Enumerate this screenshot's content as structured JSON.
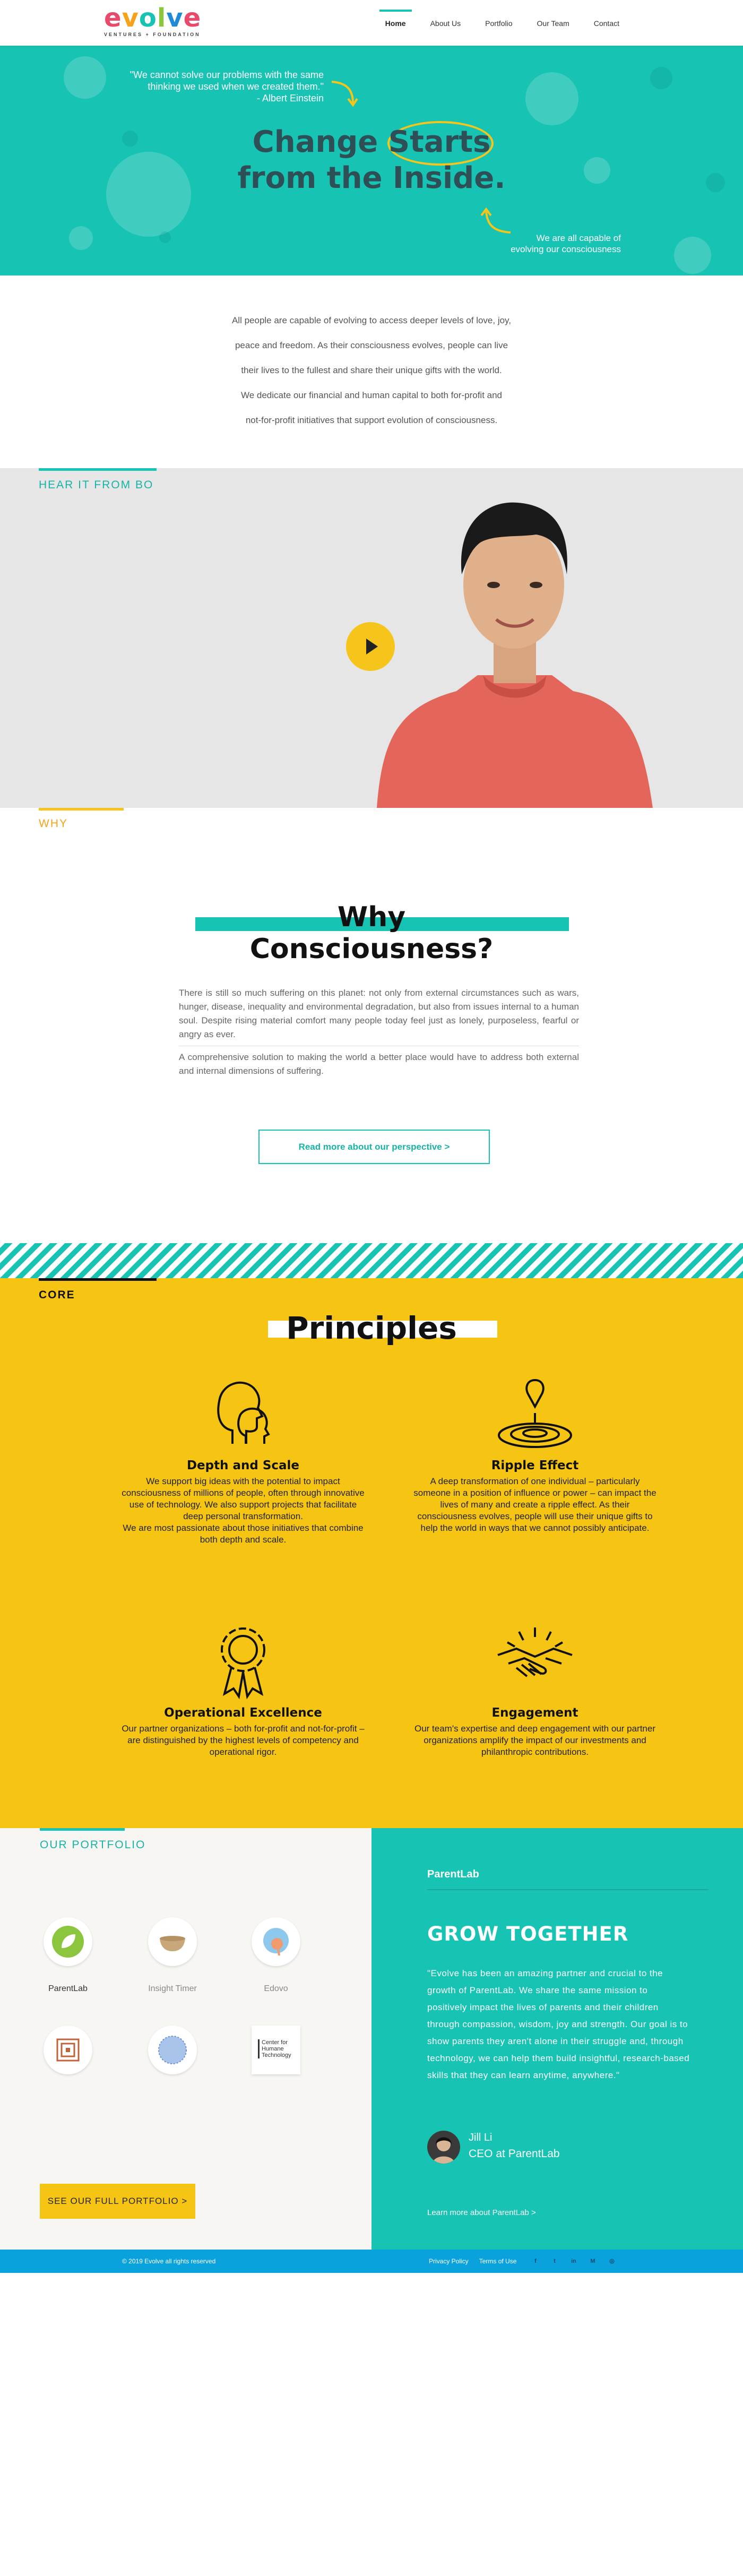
{
  "brand": {
    "logo_text": "evolve",
    "logo_sub": "VENTURES + FOUNDATION",
    "colors": {
      "teal": "#17c3b2",
      "yellow": "#f6c51b",
      "blue": "#0aa2dd"
    }
  },
  "nav": {
    "items": [
      {
        "label": "Home",
        "active": true
      },
      {
        "label": "About Us",
        "active": false
      },
      {
        "label": "Portfolio",
        "active": false
      },
      {
        "label": "Our Team",
        "active": false
      },
      {
        "label": "Contact",
        "active": false
      }
    ]
  },
  "hero": {
    "quote_line1": "\"We cannot solve our problems with the same",
    "quote_line2": "thinking we used when we created them.\"",
    "quote_author": "- Albert Einstein",
    "title_word1": "Change",
    "title_word2": "Starts",
    "title_line2": "from the Inside.",
    "note_line1": "We are all capable of",
    "note_line2": "evolving our consciousness"
  },
  "intro": {
    "lines": [
      "All people are capable of evolving to access deeper levels of love, joy,",
      "peace and freedom. As their consciousness evolves, people can live",
      "their lives to the fullest and share their unique gifts with the world.",
      "We dedicate our financial and human capital to both for-profit and",
      "not-for-profit initiatives that support evolution of consciousness."
    ]
  },
  "video": {
    "label": "HEAR IT FROM BO",
    "play_icon": "play-icon"
  },
  "why": {
    "label": "WHY",
    "title": "Why Consciousness?",
    "p1": "There is still so much suffering on this planet: not only from external circumstances such as wars, hunger, disease, inequality and environmental degradation, but also from issues internal to a human soul. Despite rising material comfort many people today feel just as lonely, purposeless, fearful or angry as ever.",
    "p2": "A comprehensive solution to making the world a better place would have to address both external and internal dimensions of suffering.",
    "button": "Read more about our perspective >"
  },
  "core": {
    "label": "CORE",
    "title": "Principles",
    "items": [
      {
        "title": "Depth and Scale",
        "icon": "heads-icon",
        "desc": "We support big ideas with the potential to impact consciousness of millions of people, often through innovative use of technology. We also support projects that facilitate deep personal transformation.",
        "desc2": "We are most passionate about those initiatives that combine both depth and scale."
      },
      {
        "title": "Ripple Effect",
        "icon": "ripple-icon",
        "desc": "A deep transformation of one individual – particularly someone in a position of influence or power – can impact the lives of many and create a ripple effect. As their consciousness evolves, people will use their unique gifts to help the world in ways that we cannot possibly anticipate.",
        "desc2": ""
      },
      {
        "title": "Operational Excellence",
        "icon": "award-gear-icon",
        "desc": "Our partner organizations – both for-profit and not-for-profit – are distinguished by the highest levels of competency and operational rigor.",
        "desc2": ""
      },
      {
        "title": "Engagement",
        "icon": "handshake-icon",
        "desc": "Our team's expertise and deep engagement with our partner organizations amplify the impact of our investments and philanthropic contributions.",
        "desc2": ""
      }
    ]
  },
  "portfolio": {
    "label": "OUR PORTFOLIO",
    "items": [
      {
        "name": "ParentLab",
        "icon": "parentlab-logo"
      },
      {
        "name": "Insight Timer",
        "icon": "insight-timer-logo"
      },
      {
        "name": "Edovo",
        "icon": "edovo-logo"
      },
      {
        "name": "",
        "icon": "maze-logo"
      },
      {
        "name": "",
        "icon": "globe-logo"
      },
      {
        "name": "",
        "icon": "center-humane-tech-logo",
        "logo_text": "Center for Humane Technology"
      }
    ],
    "button": "SEE OUR FULL PORTFOLIO >"
  },
  "testimonial": {
    "company": "ParentLab",
    "heading": "GROW TOGETHER",
    "body": "\"Evolve has been an amazing partner and crucial to the growth of ParentLab. We share the same mission to positively impact the lives of parents and their children through compassion, wisdom, joy and strength. Our goal is to show parents they aren't alone in their struggle and, through technology, we can help them build insightful, research-based skills that they can learn anytime, anywhere.\"",
    "name": "Jill Li",
    "role": "CEO at ParentLab",
    "link": "Learn more about ParentLab >"
  },
  "footer": {
    "copyright": "© 2019 Evolve all rights reserved",
    "links": [
      "Privacy Policy",
      "Terms of Use"
    ],
    "social": [
      {
        "name": "facebook-icon",
        "glyph": "f"
      },
      {
        "name": "twitter-icon",
        "glyph": "t"
      },
      {
        "name": "linkedin-icon",
        "glyph": "in"
      },
      {
        "name": "medium-icon",
        "glyph": "M"
      },
      {
        "name": "instagram-icon",
        "glyph": "◎"
      }
    ]
  }
}
